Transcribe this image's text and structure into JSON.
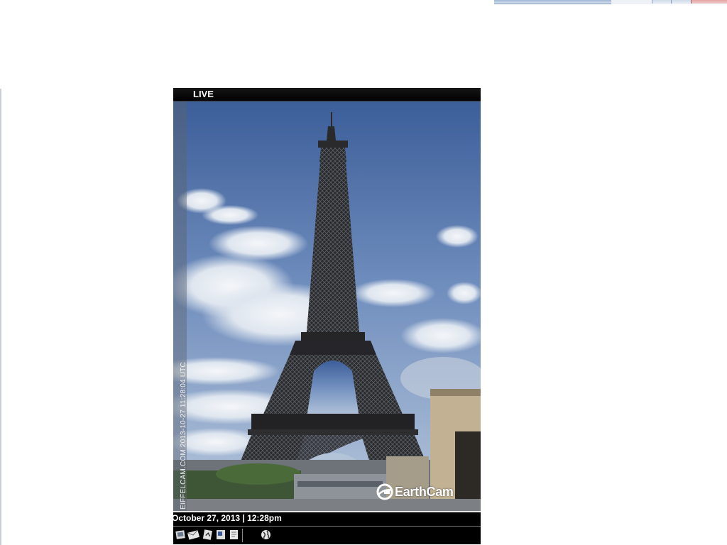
{
  "player": {
    "live_label": "LIVE",
    "watermark": "EIFFELCAM.COM 2013-10-27 11:28:04 UTC",
    "brand_name": "EarthCam",
    "date_line": "October 27, 2013 | 12:28pm"
  },
  "toolbar": {
    "icons": [
      "photo-icon",
      "email-icon",
      "share-icon",
      "facebook-icon",
      "notes-icon",
      "globe-icon"
    ]
  },
  "colors": {
    "sky_top": "#3d5f9a",
    "sky_bottom": "#a8bdd8",
    "tower": "#2b2b2e",
    "bar": "#000000"
  }
}
